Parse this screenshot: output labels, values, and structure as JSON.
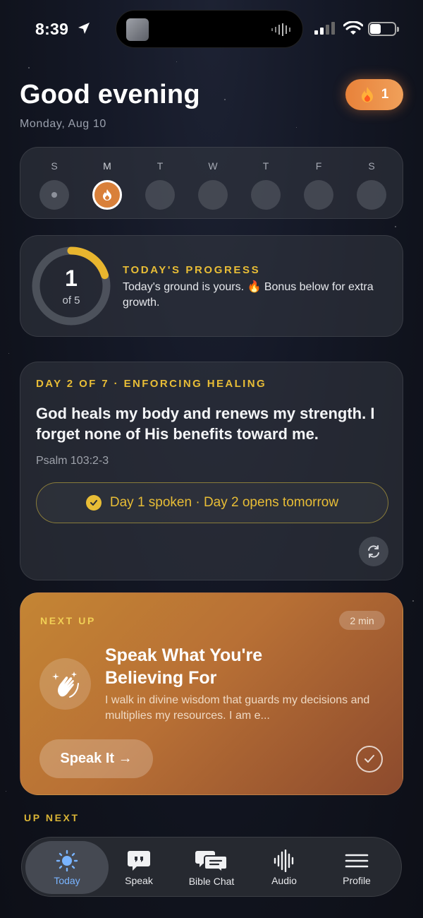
{
  "status_bar": {
    "time": "8:39"
  },
  "header": {
    "greeting": "Good evening",
    "date": "Monday, Aug 10",
    "streak_count": "1"
  },
  "week": {
    "days": [
      {
        "letter": "S",
        "state": "past"
      },
      {
        "letter": "M",
        "state": "today"
      },
      {
        "letter": "T",
        "state": "future"
      },
      {
        "letter": "W",
        "state": "future"
      },
      {
        "letter": "T",
        "state": "future"
      },
      {
        "letter": "F",
        "state": "future"
      },
      {
        "letter": "S",
        "state": "future"
      }
    ]
  },
  "progress": {
    "count": "1",
    "of_text": "of 5",
    "fraction": 0.2,
    "label": "TODAY'S PROGRESS",
    "text": "Today's ground is yours. 🔥 Bonus below for extra growth."
  },
  "daily": {
    "label": "DAY 2 OF 7 · ENFORCING HEALING",
    "text": "God heals my body and renews my strength. I forget none of His benefits toward me.",
    "reference": "Psalm 103:2-3",
    "status": "Day 1 spoken · Day 2 opens tomorrow"
  },
  "next_up": {
    "label": "NEXT UP",
    "duration": "2 min",
    "title": "Speak What You're Believing For",
    "description": "I walk in divine wisdom that guards my decisions and multiplies my resources. I am e...",
    "button": "Speak It →"
  },
  "up_next_label": "UP NEXT",
  "tabs": [
    {
      "label": "Today",
      "icon": "sun-icon",
      "active": true
    },
    {
      "label": "Speak",
      "icon": "quote-bubble-icon",
      "active": false
    },
    {
      "label": "Bible Chat",
      "icon": "chat-bubbles-icon",
      "active": false
    },
    {
      "label": "Audio",
      "icon": "audio-wave-icon",
      "active": false
    },
    {
      "label": "Profile",
      "icon": "menu-icon",
      "active": false
    }
  ],
  "colors": {
    "accent_gold": "#e8bd36",
    "streak_orange": "#e8823a",
    "active_tab_blue": "#79b4ff"
  }
}
